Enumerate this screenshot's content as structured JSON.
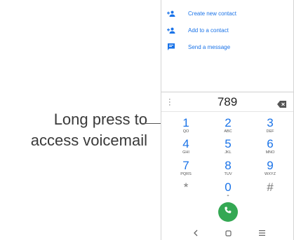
{
  "callout": {
    "line1": "Long press to",
    "line2": "access voicemail"
  },
  "actions": [
    {
      "icon": "add-person-icon",
      "label": "Create new contact"
    },
    {
      "icon": "add-person-icon",
      "label": "Add to a contact"
    },
    {
      "icon": "message-icon",
      "label": "Send a message"
    }
  ],
  "dialer": {
    "number": "789",
    "keys": [
      {
        "digit": "1",
        "letters": "QO"
      },
      {
        "digit": "2",
        "letters": "ABC"
      },
      {
        "digit": "3",
        "letters": "DEF"
      },
      {
        "digit": "4",
        "letters": "GHI"
      },
      {
        "digit": "5",
        "letters": "JKL"
      },
      {
        "digit": "6",
        "letters": "MNO"
      },
      {
        "digit": "7",
        "letters": "PQRS"
      },
      {
        "digit": "8",
        "letters": "TUV"
      },
      {
        "digit": "9",
        "letters": "WXYZ"
      },
      {
        "digit": "*",
        "letters": ""
      },
      {
        "digit": "0",
        "letters": "+"
      },
      {
        "digit": "#",
        "letters": ""
      }
    ]
  },
  "colors": {
    "accent": "#1a73e8",
    "call": "#34a853"
  }
}
